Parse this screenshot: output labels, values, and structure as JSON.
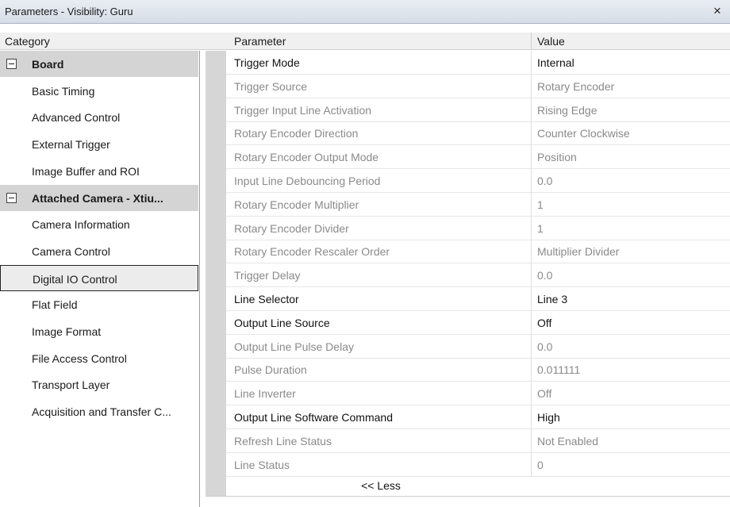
{
  "window": {
    "title": "Parameters - Visibility: Guru",
    "close_glyph": "×"
  },
  "headers": {
    "category": "Category",
    "parameter": "Parameter",
    "value": "Value"
  },
  "categories": [
    {
      "label": "Board",
      "type": "group",
      "expanded": true
    },
    {
      "label": "Basic Timing",
      "type": "item"
    },
    {
      "label": "Advanced Control",
      "type": "item"
    },
    {
      "label": "External Trigger",
      "type": "item"
    },
    {
      "label": "Image Buffer and ROI",
      "type": "item"
    },
    {
      "label": "Attached Camera - Xtiu...",
      "type": "group",
      "expanded": true
    },
    {
      "label": "Camera Information",
      "type": "item"
    },
    {
      "label": "Camera Control",
      "type": "item"
    },
    {
      "label": "Digital IO Control",
      "type": "item",
      "selected": true
    },
    {
      "label": "Flat Field",
      "type": "item"
    },
    {
      "label": "Image Format",
      "type": "item"
    },
    {
      "label": "File Access Control",
      "type": "item"
    },
    {
      "label": "Transport Layer",
      "type": "item"
    },
    {
      "label": "Acquisition and Transfer C...",
      "type": "item"
    }
  ],
  "parameters": [
    {
      "name": "Trigger Mode",
      "value": "Internal",
      "enabled": true
    },
    {
      "name": "Trigger Source",
      "value": "Rotary Encoder",
      "enabled": false
    },
    {
      "name": "Trigger Input Line Activation",
      "value": "Rising Edge",
      "enabled": false
    },
    {
      "name": "Rotary Encoder Direction",
      "value": "Counter Clockwise",
      "enabled": false
    },
    {
      "name": "Rotary Encoder Output Mode",
      "value": "Position",
      "enabled": false
    },
    {
      "name": "Input Line Debouncing Period",
      "value": "0.0",
      "enabled": false
    },
    {
      "name": "Rotary Encoder Multiplier",
      "value": "1",
      "enabled": false
    },
    {
      "name": "Rotary Encoder Divider",
      "value": "1",
      "enabled": false
    },
    {
      "name": "Rotary Encoder Rescaler Order",
      "value": "Multiplier Divider",
      "enabled": false
    },
    {
      "name": "Trigger Delay",
      "value": "0.0",
      "enabled": false
    },
    {
      "name": "Line Selector",
      "value": "Line 3",
      "enabled": true
    },
    {
      "name": "Output Line Source",
      "value": "Off",
      "enabled": true
    },
    {
      "name": "Output Line Pulse Delay",
      "value": "0.0",
      "enabled": false
    },
    {
      "name": "Pulse Duration",
      "value": "0.011111",
      "enabled": false
    },
    {
      "name": "Line Inverter",
      "value": "Off",
      "enabled": false
    },
    {
      "name": "Output Line Software Command",
      "value": "High",
      "enabled": true
    },
    {
      "name": "Refresh Line Status",
      "value": "Not Enabled",
      "enabled": false
    },
    {
      "name": "Line Status",
      "value": "0",
      "enabled": false
    }
  ],
  "less_button": "<< Less"
}
